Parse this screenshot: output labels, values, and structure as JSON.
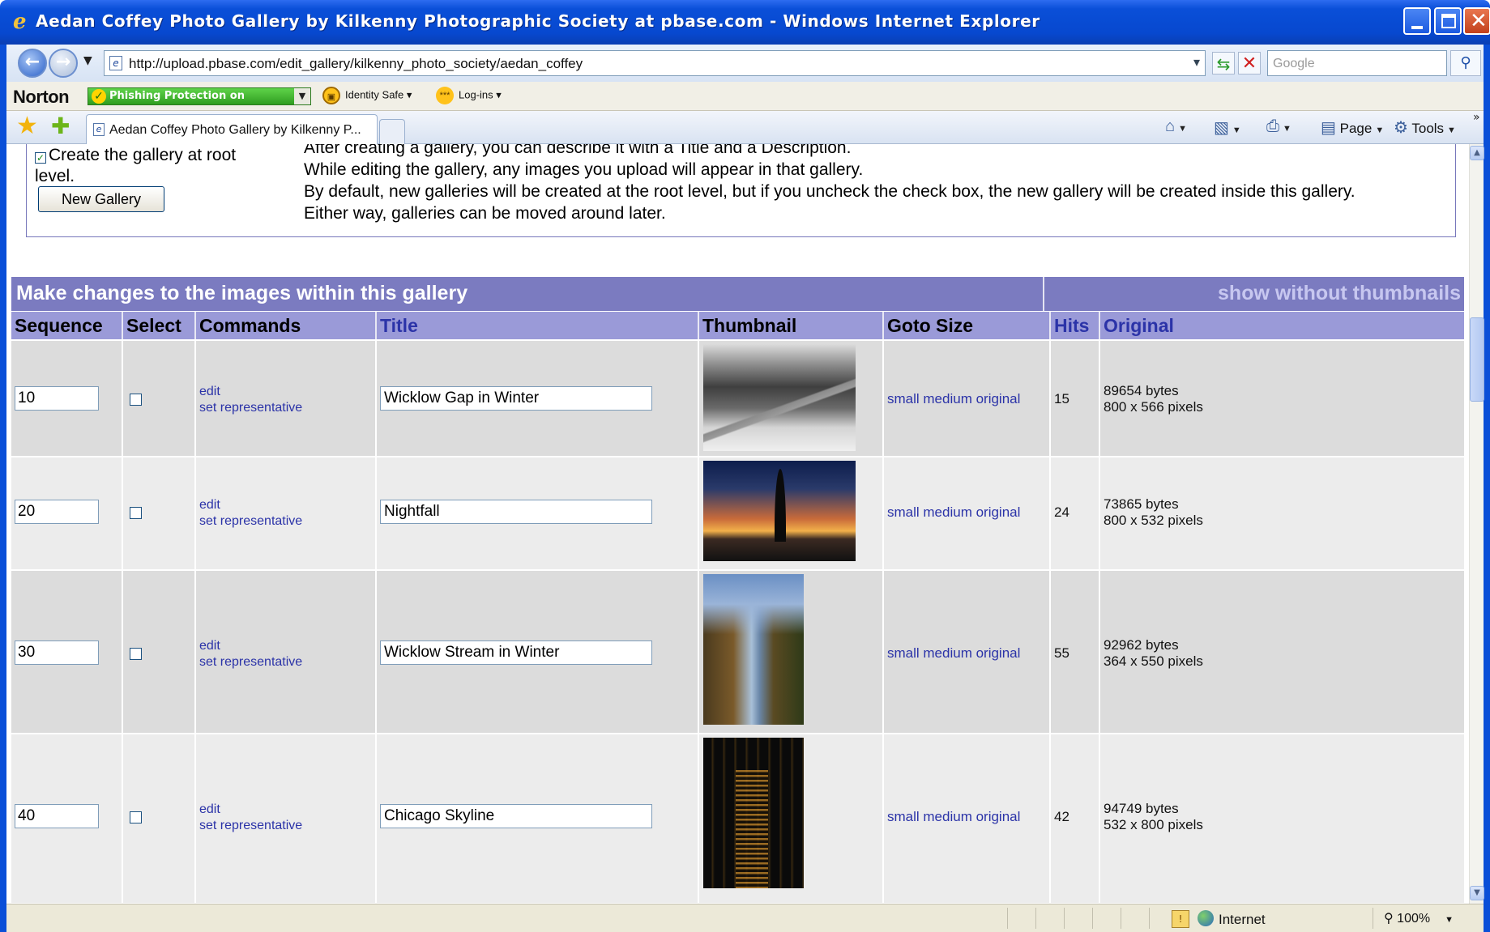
{
  "window": {
    "title": "Aedan Coffey Photo Gallery by Kilkenny Photographic Society at pbase.com - Windows Internet Explorer"
  },
  "address": {
    "url": "http://upload.pbase.com/edit_gallery/kilkenny_photo_society/aedan_coffey",
    "search_placeholder": "Google"
  },
  "norton": {
    "logo": "Norton",
    "phishing": "Phishing Protection on",
    "identity_safe": "Identity Safe",
    "logins": "Log-ins"
  },
  "tabs": {
    "active_label": "Aedan Coffey Photo Gallery by Kilkenny P..."
  },
  "command_bar": {
    "page_label": "Page",
    "tools_label": "Tools"
  },
  "gallery_info": {
    "root_checkbox_label": "Create the gallery at root level.",
    "new_gallery_button": "New Gallery",
    "lines": [
      "After creating a gallery, you can describe it with a Title and a Description.",
      "While editing the gallery, any images you upload will appear in that gallery.",
      "By default, new galleries will be created at the root level, but if you uncheck the check box, the new gallery will be created inside this gallery.",
      "Either way, galleries can be moved around later."
    ]
  },
  "image_table": {
    "banner_title": "Make changes to the images within this gallery",
    "banner_link": "show without thumbnails",
    "columns": {
      "sequence": "Sequence",
      "select": "Select",
      "commands": "Commands",
      "title": "Title",
      "thumbnail": "Thumbnail",
      "goto_size": "Goto Size",
      "hits": "Hits",
      "original": "Original"
    },
    "command_edit": "edit",
    "command_set_rep": "set representative",
    "goto_links": "small medium original",
    "rows": [
      {
        "sequence": "10",
        "title": "Wicklow Gap in Winter",
        "hits": "15",
        "bytes": "89654 bytes",
        "pixels": "800 x 566 pixels"
      },
      {
        "sequence": "20",
        "title": "Nightfall",
        "hits": "24",
        "bytes": "73865 bytes",
        "pixels": "800 x 532 pixels"
      },
      {
        "sequence": "30",
        "title": "Wicklow Stream in Winter",
        "hits": "55",
        "bytes": "92962 bytes",
        "pixels": "364 x 550 pixels"
      },
      {
        "sequence": "40",
        "title": "Chicago Skyline",
        "hits": "42",
        "bytes": "94749 bytes",
        "pixels": "532 x 800 pixels"
      }
    ]
  },
  "status": {
    "zone": "Internet",
    "zoom": "100%"
  }
}
